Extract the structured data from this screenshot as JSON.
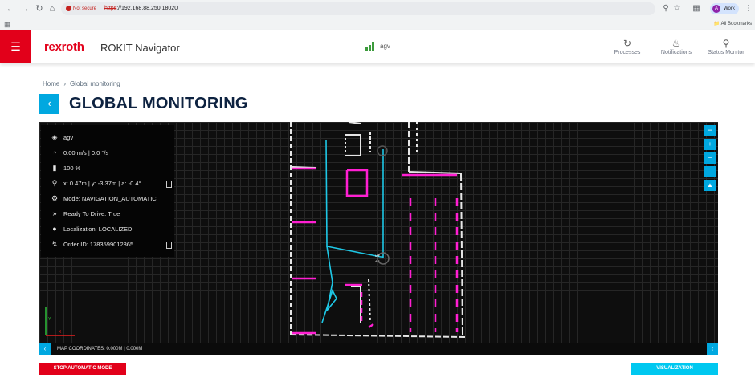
{
  "browser": {
    "back_icon": "arrow-left-icon",
    "security_label": "Not secure",
    "url_scheme": "https",
    "url_rest": "://192.168.88.250:18020",
    "profile_initial": "A",
    "profile_label": "Work",
    "bookmarks_label": "All Bookmarks"
  },
  "header": {
    "brand": "rexroth",
    "title": "ROKIT Navigator",
    "vehicle": "agv",
    "actions": [
      {
        "label": "Processes",
        "icon": "refresh-icon"
      },
      {
        "label": "Notifications",
        "icon": "bell-icon"
      },
      {
        "label": "Status Monitor",
        "icon": "zoom-search-icon"
      }
    ]
  },
  "breadcrumb": {
    "home": "Home",
    "current": "Global monitoring"
  },
  "page": {
    "title": "GLOBAL MONITORING"
  },
  "info": {
    "name": "agv",
    "speed": "0.00 m/s |  0.0 °/s",
    "battery": "100 %",
    "pose": "x: 0.47m | y: -3.37m | a: -0.4°",
    "mode": "Mode: NAVIGATION_AUTOMATIC",
    "ready": "Ready To Drive: True",
    "localization": "Localization: LOCALIZED",
    "order": "Order ID: 1783599012865"
  },
  "map": {
    "coordinates": "MAP COORDINATES: 0.000M  | 0.000M",
    "axis_y": "Y",
    "axis_x": "X",
    "robot_label_1": "IAF",
    "robot_label_2": "AG"
  },
  "buttons": {
    "stop": "STOP AUTOMATIC MODE",
    "visualization": "VISUALIZATION"
  },
  "colors": {
    "brand_red": "#e2001a",
    "accent_blue": "#00a8e0",
    "path_cyan": "#1ec8e6",
    "zone_magenta": "#ff1fd2"
  }
}
